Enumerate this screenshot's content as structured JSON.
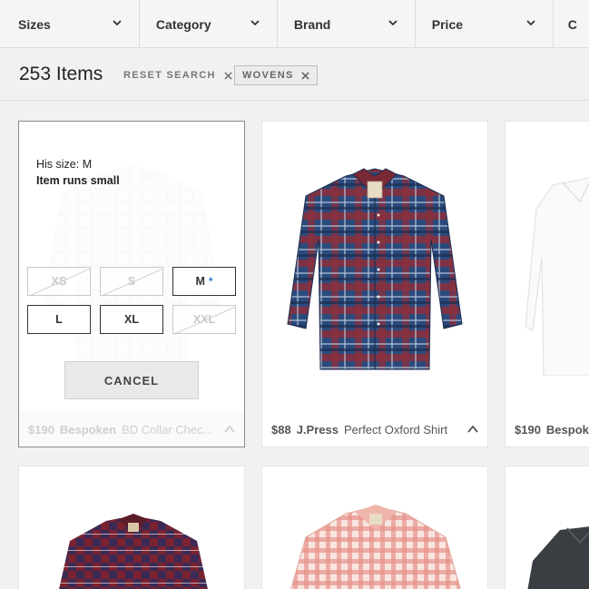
{
  "filters": [
    {
      "label": "Sizes"
    },
    {
      "label": "Category"
    },
    {
      "label": "Brand"
    },
    {
      "label": "Price"
    },
    {
      "label": "C"
    }
  ],
  "results": {
    "count_label": "253 Items",
    "reset_label": "RESET SEARCH",
    "active_tag": "WOVENS"
  },
  "size_panel": {
    "his_size": "His size: M",
    "fit_note": "Item runs small",
    "sizes": [
      {
        "label": "XS",
        "available": false
      },
      {
        "label": "S",
        "available": false
      },
      {
        "label": "M",
        "available": true,
        "marker": "*"
      },
      {
        "label": "L",
        "available": true
      },
      {
        "label": "XL",
        "available": true
      },
      {
        "label": "XXL",
        "available": false
      }
    ],
    "cancel_label": "CANCEL"
  },
  "products": [
    {
      "price": "$190",
      "brand": "Bespoken",
      "name": "BD Collar Chec..."
    },
    {
      "price": "$88",
      "brand": "J.Press",
      "name": "Perfect Oxford Shirt"
    },
    {
      "price": "$190",
      "brand": "Bespok",
      "name": ""
    }
  ],
  "colors": {
    "accent_star": "#2f7fd6",
    "plaid_navy": "#24406e",
    "plaid_red": "#8c2f3c",
    "gingham_red": "#e07a6a"
  }
}
